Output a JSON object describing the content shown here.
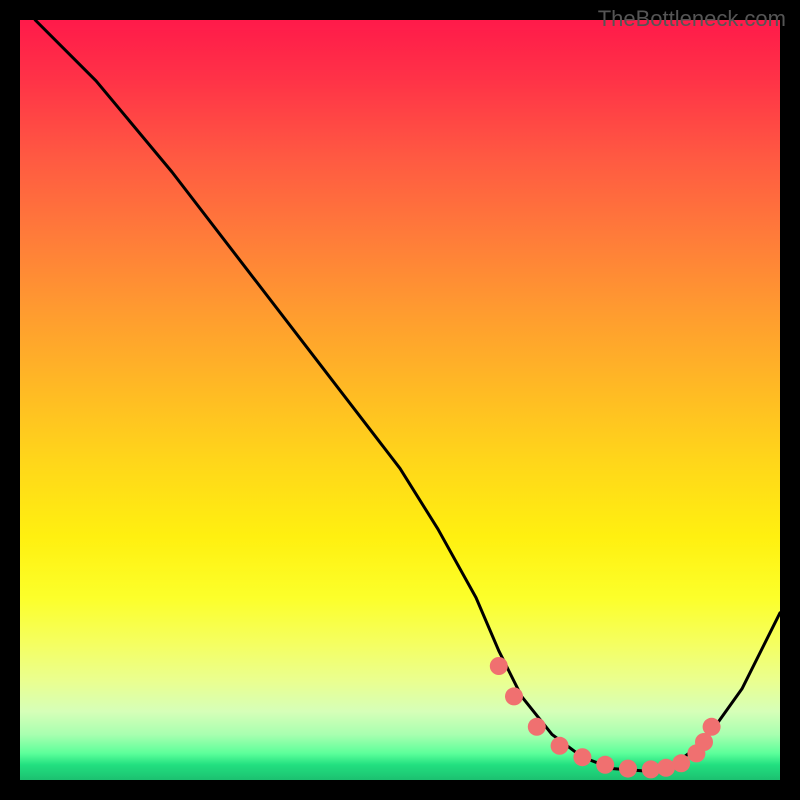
{
  "watermark": "TheBottleneck.com",
  "chart_data": {
    "type": "line",
    "title": "",
    "xlabel": "",
    "ylabel": "",
    "xlim": [
      0,
      100
    ],
    "ylim": [
      0,
      100
    ],
    "background": "heat-gradient",
    "series": [
      {
        "name": "bottleneck-curve",
        "x": [
          2,
          10,
          20,
          30,
          40,
          50,
          55,
          60,
          63,
          66,
          70,
          74,
          78,
          82,
          86,
          90,
          95,
          100
        ],
        "y": [
          100,
          92,
          80,
          67,
          54,
          41,
          33,
          24,
          17,
          11,
          6,
          3,
          1.5,
          1.2,
          2,
          5,
          12,
          22
        ]
      }
    ],
    "markers": {
      "name": "highlight-points",
      "x": [
        63,
        65,
        68,
        71,
        74,
        77,
        80,
        83,
        85,
        87,
        89,
        90,
        91
      ],
      "y": [
        15,
        11,
        7,
        4.5,
        3,
        2,
        1.5,
        1.4,
        1.6,
        2.2,
        3.5,
        5,
        7
      ]
    }
  }
}
